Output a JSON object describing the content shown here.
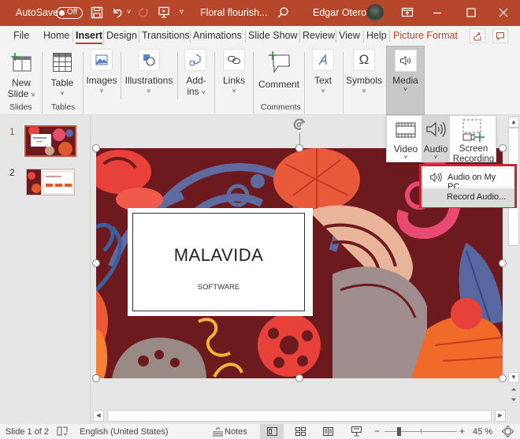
{
  "titlebar": {
    "autosave_label": "AutoSave",
    "autosave_state": "Off",
    "doc_title": "Floral flourish...",
    "user_name": "Edgar Otero",
    "icons": [
      "save-icon",
      "undo-icon",
      "redo-icon",
      "present-icon",
      "customize-icon",
      "search-icon",
      "ribbon-display-icon",
      "minimize-icon",
      "maximize-icon",
      "close-icon"
    ]
  },
  "tabs": [
    {
      "label": "File"
    },
    {
      "label": "Home"
    },
    {
      "label": "Insert",
      "selected": true
    },
    {
      "label": "Design"
    },
    {
      "label": "Transitions"
    },
    {
      "label": "Animations"
    },
    {
      "label": "Slide Show"
    },
    {
      "label": "Review"
    },
    {
      "label": "View"
    },
    {
      "label": "Help"
    },
    {
      "label": "Picture Format",
      "contextual": true
    }
  ],
  "ribbon": {
    "buttons": {
      "new_slide": "New\nSlide",
      "new_slide_l1": "New",
      "new_slide_l2": "Slide",
      "table": "Table",
      "images": "Images",
      "illustrations": "Illustrations",
      "addins_l1": "Add-",
      "addins_l2": "ins",
      "links": "Links",
      "comment": "Comment",
      "text": "Text",
      "symbols": "Symbols",
      "media": "Media"
    },
    "groups": {
      "slides": "Slides",
      "tables": "Tables",
      "comments": "Comments"
    }
  },
  "media_menu": {
    "video": "Video",
    "audio": "Audio",
    "screen_recording_l1": "Screen",
    "screen_recording_l2": "Recording"
  },
  "audio_menu": {
    "items": [
      {
        "label": "Audio on My PC...",
        "highlighted": true
      },
      {
        "label": "Record Audio..."
      }
    ]
  },
  "slides_pane": {
    "slides": [
      {
        "number": "1",
        "selected": true
      },
      {
        "number": "2"
      }
    ]
  },
  "slide": {
    "title": "MALAVIDA",
    "subtitle": "SOFTWARE"
  },
  "status": {
    "slide_info": "Slide 1 of 2",
    "language": "English (United States)",
    "notes": "Notes",
    "zoom": "45 %",
    "zoom_value_percent": 45
  },
  "colors": {
    "accent": "#b7472a",
    "highlight_box": "#d42030"
  }
}
